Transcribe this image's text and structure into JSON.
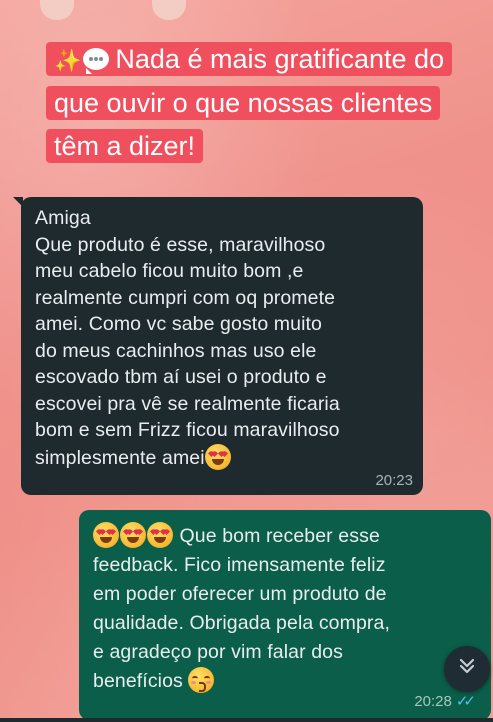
{
  "headline": {
    "line1": "Nada é mais gratificante do",
    "line2": "que ouvir o que nossas clientes",
    "line3": "têm a dizer!"
  },
  "incoming_message": {
    "sender": "Amiga",
    "text": "Que produto é esse, maravilhoso\nmeu cabelo ficou muito bom ,e\nrealmente cumpri com oq promete\namei. Como vc sabe gosto muito\ndo meus cachinhos mas uso ele\nescovado tbm aí usei o produto e\nescovei pra vê se realmente  ficaria\nbom e sem Frizz  ficou maravilhoso",
    "last_line": "simplesmente  amei",
    "time": "20:23"
  },
  "outgoing_message": {
    "first_line": "Que bom receber esse",
    "text": "feedback.  Fico imensamente feliz\nem poder oferecer um produto de\nqualidade.  Obrigada pela compra,\ne agradeço por vim falar dos",
    "last_line": "benefícios",
    "time": "20:28",
    "status": "read"
  },
  "icons": {
    "sparkles": "sparkles-icon",
    "speech_bubble": "speech-bubble-icon",
    "heart_eyes": "heart-eyes-emoji",
    "kissing_face": "kissing-face-emoji",
    "read_ticks": "double-check-icon",
    "scroll_down": "chevron-double-down-icon"
  },
  "colors": {
    "headline_highlight": "#f0505e",
    "incoming_bubble": "#1f2a2e",
    "outgoing_bubble": "#0b5e49",
    "read_tick": "#53bdeb"
  }
}
